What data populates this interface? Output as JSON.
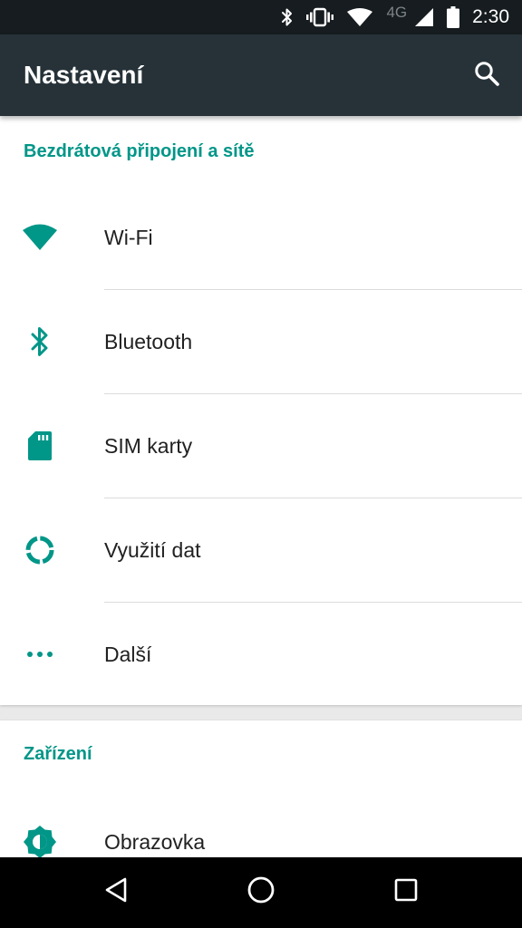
{
  "status_bar": {
    "network_label": "4G",
    "time": "2:30",
    "icons": [
      "bluetooth-icon",
      "vibrate-icon",
      "wifi-signal-icon",
      "cell-signal-icon",
      "battery-icon"
    ]
  },
  "app_bar": {
    "title": "Nastavení",
    "search_icon": "search-icon"
  },
  "sections": [
    {
      "header": "Bezdrátová připojení a sítě",
      "items": [
        {
          "label": "Wi-Fi",
          "icon": "wifi-icon"
        },
        {
          "label": "Bluetooth",
          "icon": "bluetooth-icon"
        },
        {
          "label": "SIM karty",
          "icon": "sim-card-icon"
        },
        {
          "label": "Využití dat",
          "icon": "data-usage-icon"
        },
        {
          "label": "Další",
          "icon": "more-dots-icon"
        }
      ]
    },
    {
      "header": "Zařízení",
      "items": [
        {
          "label": "Obrazovka",
          "icon": "display-brightness-icon"
        }
      ]
    }
  ],
  "nav_bar": {
    "buttons": [
      "back-icon",
      "home-icon",
      "recents-icon"
    ]
  },
  "colors": {
    "accent": "#009688",
    "app_bar": "#263238",
    "status_bar": "#161c1f",
    "text_primary": "#212121"
  }
}
